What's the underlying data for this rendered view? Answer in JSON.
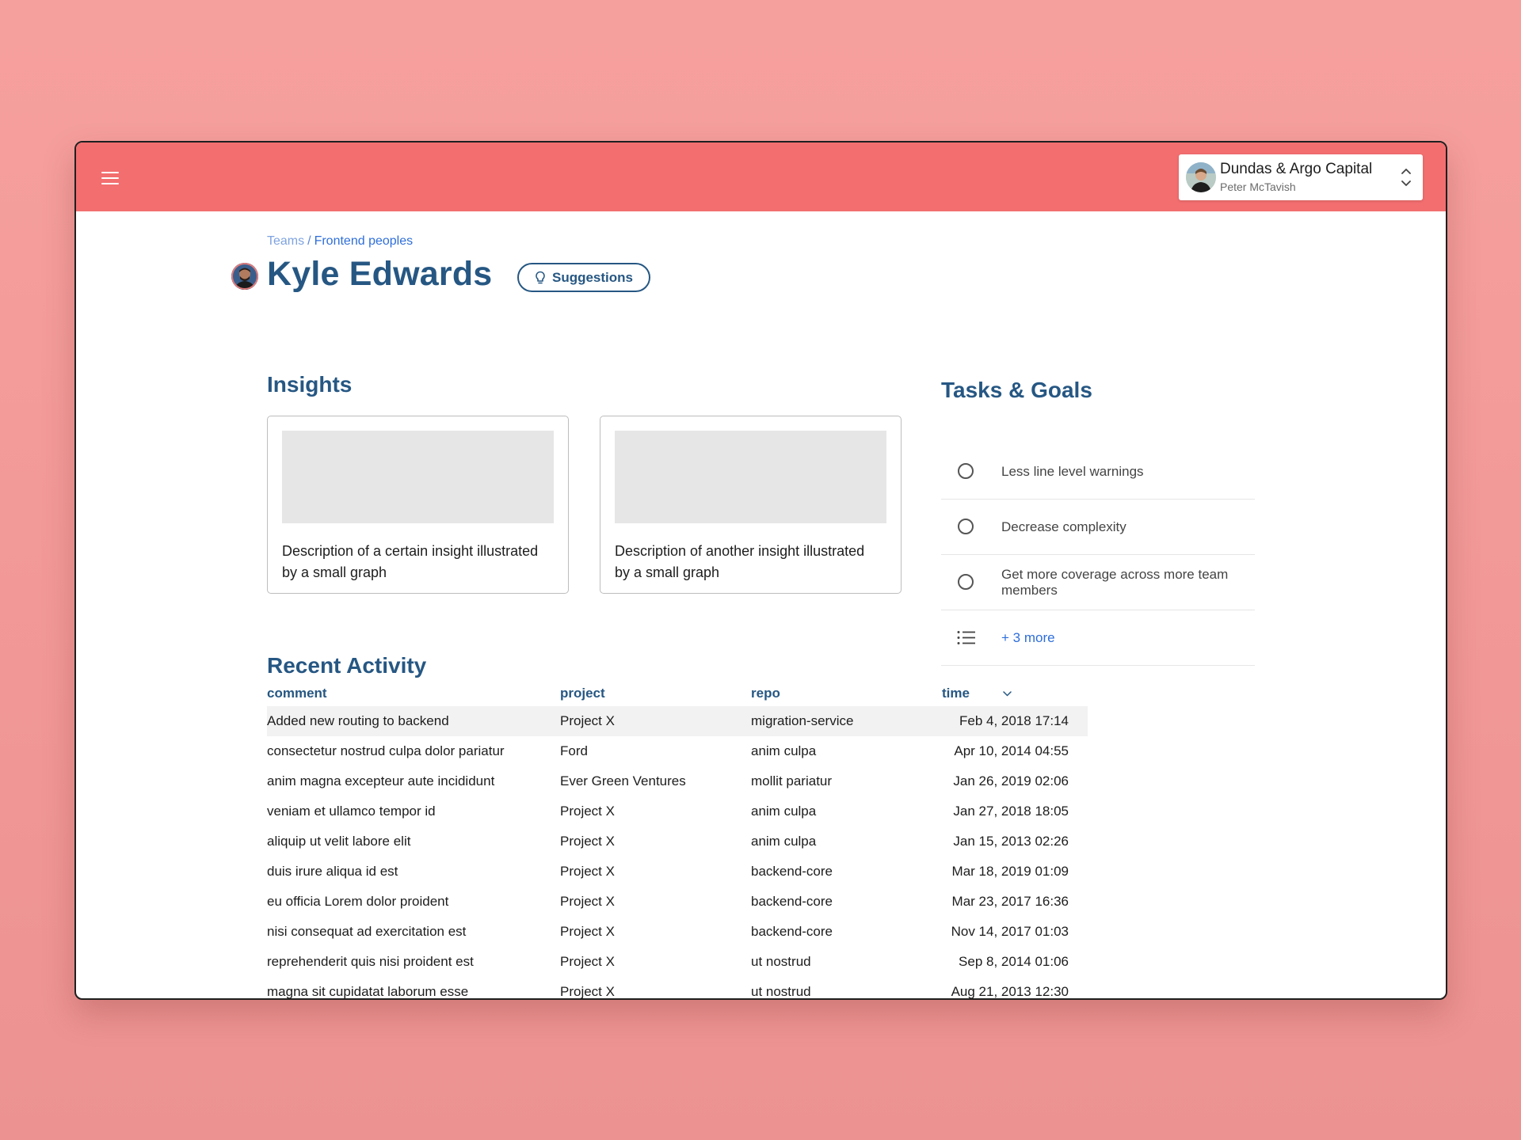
{
  "account": {
    "company": "Dundas & Argo Capital",
    "user": "Peter McTavish"
  },
  "breadcrumb": {
    "root": "Teams",
    "separator": "/",
    "current": "Frontend peoples"
  },
  "profile": {
    "name": "Kyle Edwards",
    "suggestions_label": "Suggestions"
  },
  "insights": {
    "title": "Insights",
    "cards": [
      {
        "description": "Description of a certain insight illustrated by a small graph"
      },
      {
        "description": "Description of another insight illustrated by a small graph"
      }
    ]
  },
  "tasks": {
    "title": "Tasks & Goals",
    "items": [
      {
        "label": "Less line level warnings"
      },
      {
        "label": "Decrease complexity"
      },
      {
        "label": "Get more coverage across more team members"
      }
    ],
    "more_label": "+ 3 more"
  },
  "activity": {
    "title": "Recent Activity",
    "columns": {
      "comment": "comment",
      "project": "project",
      "repo": "repo",
      "time": "time"
    },
    "rows": [
      {
        "comment": "Added new routing to backend",
        "project": "Project X",
        "repo": "migration-service",
        "time": "Feb 4, 2018 17:14"
      },
      {
        "comment": "consectetur nostrud culpa dolor pariatur",
        "project": "Ford",
        "repo": "anim culpa",
        "time": "Apr 10, 2014 04:55"
      },
      {
        "comment": "anim magna excepteur aute incididunt",
        "project": "Ever Green Ventures",
        "repo": "mollit pariatur",
        "time": "Jan 26, 2019 02:06"
      },
      {
        "comment": "veniam et ullamco tempor id",
        "project": "Project X",
        "repo": "anim culpa",
        "time": "Jan 27, 2018 18:05"
      },
      {
        "comment": "aliquip ut velit labore elit",
        "project": "Project X",
        "repo": "anim culpa",
        "time": "Jan 15, 2013 02:26"
      },
      {
        "comment": "duis irure aliqua id est",
        "project": "Project X",
        "repo": "backend-core",
        "time": "Mar 18, 2019 01:09"
      },
      {
        "comment": "eu officia Lorem dolor proident",
        "project": "Project X",
        "repo": "backend-core",
        "time": "Mar 23, 2017 16:36"
      },
      {
        "comment": "nisi consequat ad exercitation est",
        "project": "Project X",
        "repo": "backend-core",
        "time": "Nov 14, 2017 01:03"
      },
      {
        "comment": "reprehenderit quis nisi proident est",
        "project": "Project X",
        "repo": "ut nostrud",
        "time": "Sep 8, 2014 01:06"
      },
      {
        "comment": "magna sit cupidatat laborum esse",
        "project": "Project X",
        "repo": "ut nostrud",
        "time": "Aug 21, 2013 12:30"
      }
    ]
  },
  "icons": {
    "menu": "hamburger-menu-icon",
    "switcher": "chevron-up-down-icon",
    "suggestions": "lightbulb-icon",
    "task": "empty-circle-icon",
    "more": "list-icon",
    "sort": "chevron-down-icon"
  },
  "colors": {
    "topbar": "#f26e6f",
    "primary": "#265783",
    "link": "#2e6ed9",
    "background": "#f6a09e"
  }
}
